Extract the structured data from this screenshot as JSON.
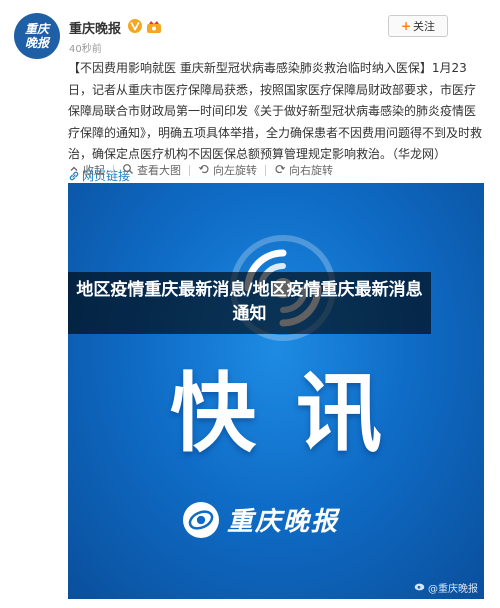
{
  "post": {
    "author": {
      "name": "重庆晚报",
      "avatar_text": "重庆晚报",
      "verified_icon": "verified-v-icon",
      "badge_icon": "vip-badge-icon"
    },
    "timestamp": "40秒前",
    "follow_button": {
      "plus": "+",
      "label": "关注"
    },
    "body": {
      "headline": "【不因费用影响就医 重庆新型冠状病毒感染肺炎救治临时纳入医保】",
      "text": "1月23日，记者从重庆市医疗保障局获悉，按照国家医疗保障局财政部要求，市医疗保障局联合市财政局第一时间印发《关于做好新型冠状病毒感染的肺炎疫情医疗保障的通知》，明确五项具体举措，全力确保患者不因费用问题得不到及时救治，确保定点医疗机构不因医保总额预算管理规定影响救治。（华龙网）",
      "link_label": "网页链接",
      "link_icon": "link-icon"
    },
    "actions": [
      {
        "icon": "collect-icon",
        "label": "收起"
      },
      {
        "icon": "zoom-icon",
        "label": "查看大图"
      },
      {
        "icon": "rotate-left-icon",
        "label": "向左旋转"
      },
      {
        "icon": "rotate-right-icon",
        "label": "向右旋转"
      }
    ],
    "image": {
      "big_text": "快讯",
      "brand": "重庆晚报",
      "watermark": "@重庆晚报"
    },
    "overlay_title": "地区疫情重庆最新消息/地区疫情重庆最新消息通知"
  },
  "colors": {
    "accent_orange": "#ff8200",
    "link_blue": "#1f7fbf",
    "image_blue": "#0f6cc6"
  }
}
